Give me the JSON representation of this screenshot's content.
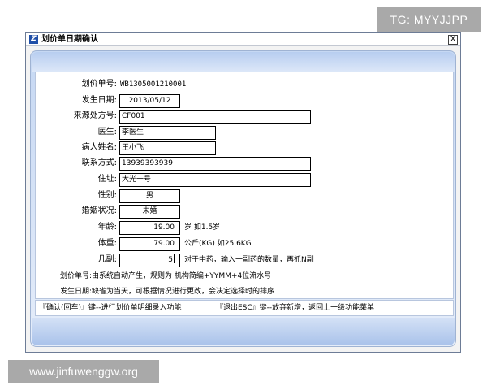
{
  "watermarks": {
    "top": "TG: MYYJJPP",
    "bottom": "www.jinfuwenggw.org"
  },
  "window": {
    "title": "划价单日期确认",
    "close_label": "X"
  },
  "form": {
    "bill_no": {
      "label": "划价单号:",
      "value": "WB1305001210001"
    },
    "date": {
      "label": "发生日期:",
      "value": "2013/05/12"
    },
    "rx_no": {
      "label": "来源处方号:",
      "value": "CF001"
    },
    "doctor": {
      "label": "医生:",
      "value": "李医生"
    },
    "patient": {
      "label": "病人姓名:",
      "value": "王小飞"
    },
    "phone": {
      "label": "联系方式:",
      "value": "13939393939"
    },
    "address": {
      "label": "住址:",
      "value": "大光一号"
    },
    "gender": {
      "label": "性别:",
      "value": "男"
    },
    "marital": {
      "label": "婚姻状况:",
      "value": "未婚"
    },
    "age": {
      "label": "年龄:",
      "value": "19.00",
      "suffix": "岁 如1.5岁"
    },
    "weight": {
      "label": "体重:",
      "value": "79.00",
      "suffix": "公斤(KG)  如25.6KG"
    },
    "doses": {
      "label": "几副:",
      "value": "5",
      "suffix": "对于中药，输入一副药的数量，再抓N副"
    }
  },
  "notes": [
    "划价单号:由系统自动产生，规则为 机构简编+YYMM+4位流水号",
    "发生日期:缺省为当天，可根据情况进行更改，会决定选择时的排序"
  ],
  "status": {
    "enter_hint": "『确认(回车)』键--进行划价单明细录入功能",
    "esc_hint": "『退出ESC』键--放弃新增，返回上一级功能菜单"
  }
}
